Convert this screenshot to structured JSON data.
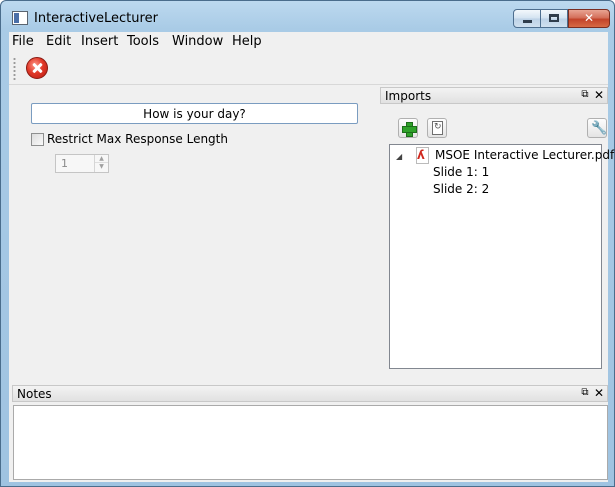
{
  "window": {
    "title": "InteractiveLecturer",
    "controls": {
      "minimize": "minimize",
      "maximize": "maximize",
      "close": "✕"
    }
  },
  "menubar": {
    "items": [
      "File",
      "Edit",
      "Insert",
      "Tools",
      "Window",
      "Help"
    ]
  },
  "toolbar": {
    "buttons": [
      {
        "icon": "stop-icon"
      }
    ]
  },
  "central": {
    "question_text": "How is your day?",
    "restrict_label": "Restrict Max Response Length",
    "restrict_checked": false,
    "max_length_value": "1"
  },
  "imports": {
    "title": "Imports",
    "tree": {
      "file_name": "MSOE Interactive Lecturer.pdf",
      "slides": [
        "Slide 1: 1",
        "Slide 2: 2"
      ]
    }
  },
  "notes": {
    "title": "Notes",
    "content": ""
  },
  "colors": {
    "titlebar": "#a9cbe6",
    "close_button": "#c2432a",
    "stop_icon": "#e13a2a",
    "add_icon": "#2fa12a"
  }
}
